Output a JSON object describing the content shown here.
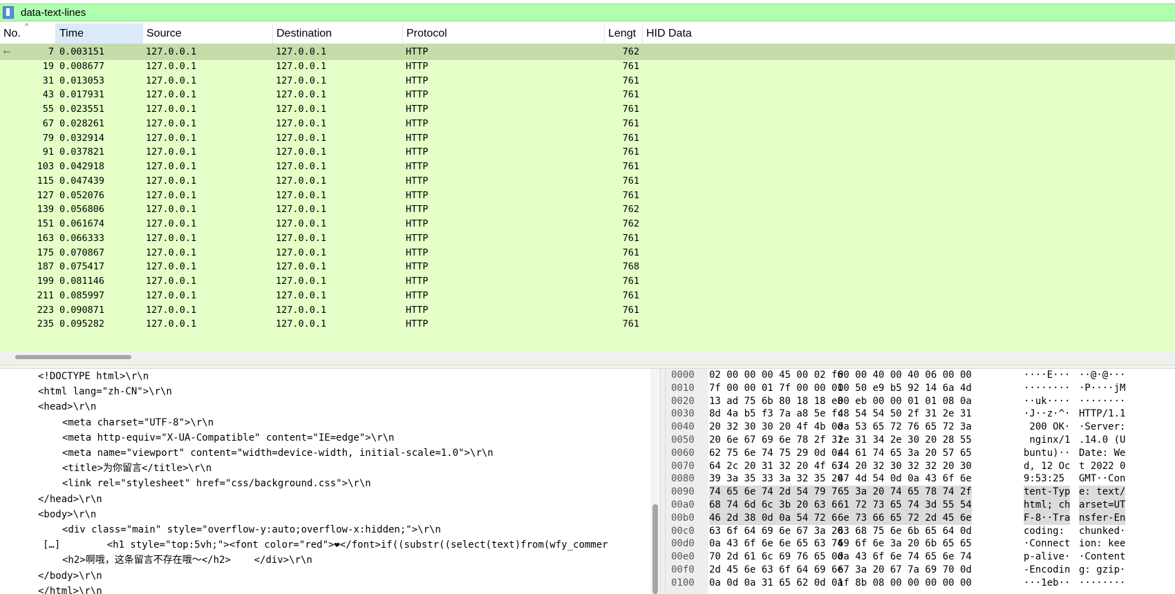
{
  "filter": {
    "text": "data-text-lines"
  },
  "packet_list": {
    "columns": [
      "No.",
      "Time",
      "Source",
      "Destination",
      "Protocol",
      "Lengt",
      "HID Data"
    ],
    "sort_indicator": "^",
    "rows": [
      {
        "no": "7",
        "time": "0.003151",
        "src": "127.0.0.1",
        "dst": "127.0.0.1",
        "proto": "HTTP",
        "len": "762"
      },
      {
        "no": "19",
        "time": "0.008677",
        "src": "127.0.0.1",
        "dst": "127.0.0.1",
        "proto": "HTTP",
        "len": "761"
      },
      {
        "no": "31",
        "time": "0.013053",
        "src": "127.0.0.1",
        "dst": "127.0.0.1",
        "proto": "HTTP",
        "len": "761"
      },
      {
        "no": "43",
        "time": "0.017931",
        "src": "127.0.0.1",
        "dst": "127.0.0.1",
        "proto": "HTTP",
        "len": "761"
      },
      {
        "no": "55",
        "time": "0.023551",
        "src": "127.0.0.1",
        "dst": "127.0.0.1",
        "proto": "HTTP",
        "len": "761"
      },
      {
        "no": "67",
        "time": "0.028261",
        "src": "127.0.0.1",
        "dst": "127.0.0.1",
        "proto": "HTTP",
        "len": "761"
      },
      {
        "no": "79",
        "time": "0.032914",
        "src": "127.0.0.1",
        "dst": "127.0.0.1",
        "proto": "HTTP",
        "len": "761"
      },
      {
        "no": "91",
        "time": "0.037821",
        "src": "127.0.0.1",
        "dst": "127.0.0.1",
        "proto": "HTTP",
        "len": "761"
      },
      {
        "no": "103",
        "time": "0.042918",
        "src": "127.0.0.1",
        "dst": "127.0.0.1",
        "proto": "HTTP",
        "len": "761"
      },
      {
        "no": "115",
        "time": "0.047439",
        "src": "127.0.0.1",
        "dst": "127.0.0.1",
        "proto": "HTTP",
        "len": "761"
      },
      {
        "no": "127",
        "time": "0.052076",
        "src": "127.0.0.1",
        "dst": "127.0.0.1",
        "proto": "HTTP",
        "len": "761"
      },
      {
        "no": "139",
        "time": "0.056806",
        "src": "127.0.0.1",
        "dst": "127.0.0.1",
        "proto": "HTTP",
        "len": "762"
      },
      {
        "no": "151",
        "time": "0.061674",
        "src": "127.0.0.1",
        "dst": "127.0.0.1",
        "proto": "HTTP",
        "len": "762"
      },
      {
        "no": "163",
        "time": "0.066333",
        "src": "127.0.0.1",
        "dst": "127.0.0.1",
        "proto": "HTTP",
        "len": "761"
      },
      {
        "no": "175",
        "time": "0.070867",
        "src": "127.0.0.1",
        "dst": "127.0.0.1",
        "proto": "HTTP",
        "len": "761"
      },
      {
        "no": "187",
        "time": "0.075417",
        "src": "127.0.0.1",
        "dst": "127.0.0.1",
        "proto": "HTTP",
        "len": "768"
      },
      {
        "no": "199",
        "time": "0.081146",
        "src": "127.0.0.1",
        "dst": "127.0.0.1",
        "proto": "HTTP",
        "len": "761"
      },
      {
        "no": "211",
        "time": "0.085997",
        "src": "127.0.0.1",
        "dst": "127.0.0.1",
        "proto": "HTTP",
        "len": "761"
      },
      {
        "no": "223",
        "time": "0.090871",
        "src": "127.0.0.1",
        "dst": "127.0.0.1",
        "proto": "HTTP",
        "len": "761"
      },
      {
        "no": "235",
        "time": "0.095282",
        "src": "127.0.0.1",
        "dst": "127.0.0.1",
        "proto": "HTTP",
        "len": "761"
      }
    ]
  },
  "text_pane": {
    "lines": [
      "<!DOCTYPE html>\\r\\n",
      "<html lang=\"zh-CN\">\\r\\n",
      "<head>\\r\\n",
      "<meta charset=\"UTF-8\">\\r\\n",
      "<meta http-equiv=\"X-UA-Compatible\" content=\"IE=edge\">\\r\\n",
      "<meta name=\"viewport\" content=\"width=device-width, initial-scale=1.0\">\\r\\n",
      "<title>为你留言</title>\\r\\n",
      "<link rel=\"stylesheet\" href=\"css/background.css\">\\r\\n",
      "</head>\\r\\n",
      "<body>\\r\\n",
      "<div class=\"main\" style=\"overflow-y:auto;overflow-x:hidden;\">\\r\\n",
      "[…]        <h1 style=\"top:5vh;\"><font color=\"red\">❤</font>if((substr((select(text)from(wfy_commer",
      "<h2>啊哦，这条留言不存在哦～</h2>    </div>\\r\\n",
      "</body>\\r\\n",
      "</html>\\r\\n"
    ]
  },
  "hex_pane": {
    "rows": [
      {
        "off": "0000",
        "b1": "02 00 00 00 45 00 02 f6",
        "b2": "00 00 40 00 40 06 00 00",
        "a1": "····E···",
        "a2": "··@·@···"
      },
      {
        "off": "0010",
        "b1": "7f 00 00 01 7f 00 00 01",
        "b2": "00 50 e9 b5 92 14 6a 4d",
        "a1": "········",
        "a2": "·P····jM"
      },
      {
        "off": "0020",
        "b1": "13 ad 75 6b 80 18 18 e8",
        "b2": "00 eb 00 00 01 01 08 0a",
        "a1": "··uk····",
        "a2": "········"
      },
      {
        "off": "0030",
        "b1": "8d 4a b5 f3 7a a8 5e fc",
        "b2": "48 54 54 50 2f 31 2e 31",
        "a1": "·J··z·^·",
        "a2": "HTTP/1.1"
      },
      {
        "off": "0040",
        "b1": "20 32 30 30 20 4f 4b 0d",
        "b2": "0a 53 65 72 76 65 72 3a",
        "a1": " 200 OK·",
        "a2": "·Server:"
      },
      {
        "off": "0050",
        "b1": "20 6e 67 69 6e 78 2f 31",
        "b2": "2e 31 34 2e 30 20 28 55",
        "a1": " nginx/1",
        "a2": ".14.0 (U"
      },
      {
        "off": "0060",
        "b1": "62 75 6e 74 75 29 0d 0a",
        "b2": "44 61 74 65 3a 20 57 65",
        "a1": "buntu)··",
        "a2": "Date: We"
      },
      {
        "off": "0070",
        "b1": "64 2c 20 31 32 20 4f 63",
        "b2": "74 20 32 30 32 32 20 30",
        "a1": "d, 12 Oc",
        "a2": "t 2022 0"
      },
      {
        "off": "0080",
        "b1": "39 3a 35 33 3a 32 35 20",
        "b2": "47 4d 54 0d 0a 43 6f 6e",
        "a1": "9:53:25 ",
        "a2": "GMT··Con"
      },
      {
        "off": "0090",
        "b1": "74 65 6e 74 2d 54 79 70",
        "b2": "65 3a 20 74 65 78 74 2f",
        "a1": "tent-Typ",
        "a2": "e: text/"
      },
      {
        "off": "00a0",
        "b1": "68 74 6d 6c 3b 20 63 68",
        "b2": "61 72 73 65 74 3d 55 54",
        "a1": "html; ch",
        "a2": "arset=UT"
      },
      {
        "off": "00b0",
        "b1": "46 2d 38 0d 0a 54 72 61",
        "b2": "6e 73 66 65 72 2d 45 6e",
        "a1": "F-8··Tra",
        "a2": "nsfer-En"
      },
      {
        "off": "00c0",
        "b1": "63 6f 64 69 6e 67 3a 20",
        "b2": "63 68 75 6e 6b 65 64 0d",
        "a1": "coding: ",
        "a2": "chunked·"
      },
      {
        "off": "00d0",
        "b1": "0a 43 6f 6e 6e 65 63 74",
        "b2": "69 6f 6e 3a 20 6b 65 65",
        "a1": "·Connect",
        "a2": "ion: kee"
      },
      {
        "off": "00e0",
        "b1": "70 2d 61 6c 69 76 65 0d",
        "b2": "0a 43 6f 6e 74 65 6e 74",
        "a1": "p-alive·",
        "a2": "·Content"
      },
      {
        "off": "00f0",
        "b1": "2d 45 6e 63 6f 64 69 6e",
        "b2": "67 3a 20 67 7a 69 70 0d",
        "a1": "-Encodin",
        "a2": "g: gzip·"
      },
      {
        "off": "0100",
        "b1": "0a 0d 0a 31 65 62 0d 0a",
        "b2": "1f 8b 08 00 00 00 00 00",
        "a1": "···1eb··",
        "a2": "········"
      }
    ]
  }
}
